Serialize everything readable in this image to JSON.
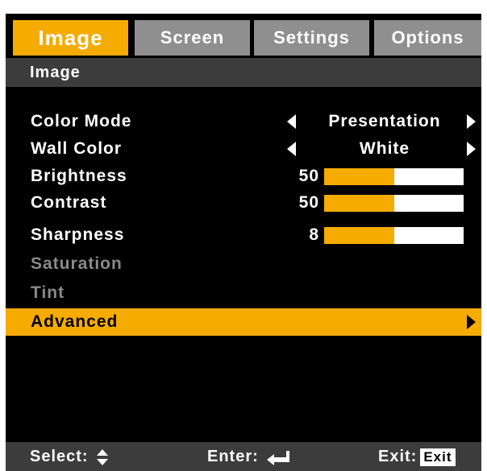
{
  "tabs": [
    {
      "label": "Image",
      "active": true
    },
    {
      "label": "Screen",
      "active": false
    },
    {
      "label": "Settings",
      "active": false
    },
    {
      "label": "Options",
      "active": false
    }
  ],
  "section_title": "Image",
  "rows": {
    "color_mode": {
      "label": "Color Mode",
      "value": "Presentation"
    },
    "wall_color": {
      "label": "Wall Color",
      "value": "White"
    },
    "brightness": {
      "label": "Brightness",
      "value": "50",
      "level": 0.5
    },
    "contrast": {
      "label": "Contrast",
      "value": "50",
      "level": 0.5
    },
    "sharpness": {
      "label": "Sharpness",
      "value": "8",
      "level": 0.5
    },
    "saturation": {
      "label": "Saturation"
    },
    "tint": {
      "label": "Tint"
    },
    "advanced": {
      "label": "Advanced"
    }
  },
  "footer": {
    "select_label": "Select:",
    "enter_label": "Enter:",
    "exit_label": "Exit:",
    "exit_key": "Exit"
  },
  "colors": {
    "accent": "#f5ab00",
    "tab_inactive": "#8f8f8f",
    "bar_background": "#3c3c3c",
    "disabled_text": "#8a8a8a"
  },
  "icons": {
    "left_arrow": "triangle-left-icon",
    "right_arrow": "triangle-right-icon",
    "select": "up-down-arrows-icon",
    "enter": "enter-return-icon"
  }
}
